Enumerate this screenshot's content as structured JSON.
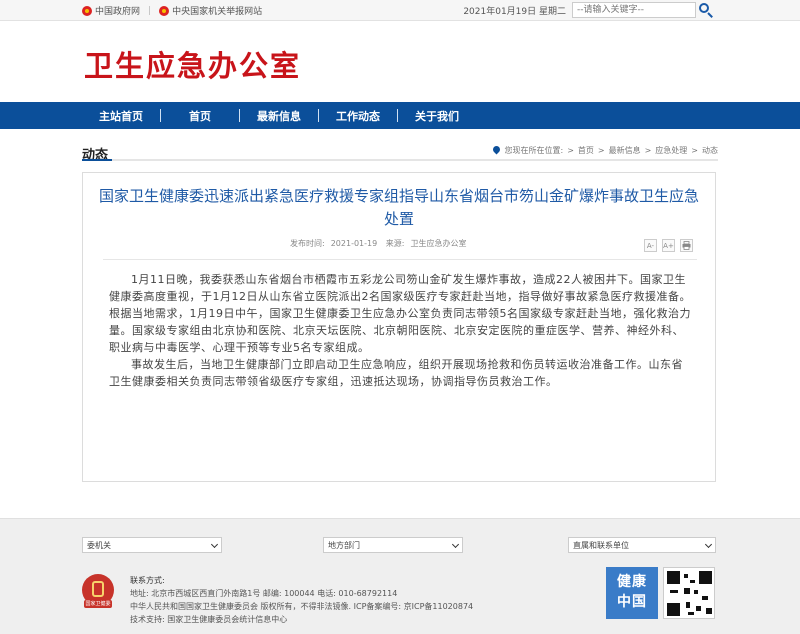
{
  "topbar": {
    "links": [
      "中国政府网",
      "中央国家机关举报网站"
    ],
    "date": "2021年01月19日 星期二",
    "search_placeholder": "--请输入关键字--"
  },
  "header": {
    "site_title": "卫生应急办公室"
  },
  "nav": {
    "items": [
      "主站首页",
      "首页",
      "最新信息",
      "工作动态",
      "关于我们"
    ]
  },
  "section": {
    "title": "动态",
    "breadcrumb_prefix": "您现在所在位置:",
    "breadcrumb": [
      "首页",
      "最新信息",
      "应急处理",
      "动态"
    ]
  },
  "article": {
    "title": "国家卫生健康委迅速派出紧急医疗救援专家组指导山东省烟台市笏山金矿爆炸事故卫生应急处置",
    "publish_label": "发布时间:",
    "publish_date": "2021-01-19",
    "source_label": "来源:",
    "source": "卫生应急办公室",
    "tools": [
      "A-",
      "A+",
      "打印"
    ],
    "paragraphs": [
      "1月11日晚，我委获悉山东省烟台市栖霞市五彩龙公司笏山金矿发生爆炸事故，造成22人被困井下。国家卫生健康委高度重视，于1月12日从山东省立医院派出2名国家级医疗专家赶赴当地，指导做好事故紧急医疗救援准备。根据当地需求，1月19日中午，国家卫生健康委卫生应急办公室负责同志带领5名国家级专家赶赴当地，强化救治力量。国家级专家组由北京协和医院、北京天坛医院、北京朝阳医院、北京安定医院的重症医学、营养、神经外科、职业病与中毒医学、心理干预等专业5名专家组成。",
      "事故发生后，当地卫生健康部门立即启动卫生应急响应，组织开展现场抢救和伤员转运收治准备工作。山东省卫生健康委相关负责同志带领省级医疗专家组，迅速抵达现场，协调指导伤员救治工作。"
    ]
  },
  "footer": {
    "selects": [
      "委机关",
      "地方部门",
      "直属和联系单位"
    ],
    "logo_text": "国家卫健委",
    "contact_title": "联系方式:",
    "address": "地址: 北京市西城区西直门外南路1号    邮编: 100044    电话: 010-68792114",
    "copyright": "中华人民共和国国家卫生健康委员会    版权所有，不得非法镜像.    ICP备案编号: 京ICP备11020874",
    "support": "技术支持: 国家卫生健康委员会统计信息中心",
    "badge_lines": [
      "健康",
      "中国"
    ]
  },
  "colors": {
    "brand_red": "#c8141a",
    "nav_blue": "#0b4f9a",
    "title_blue": "#1f5aa6"
  },
  "icons": [
    "emblem-icon",
    "search-icon",
    "location-pin-icon",
    "font-decrease-icon",
    "font-increase-icon",
    "print-icon",
    "chevron-down-icon",
    "qr-code-icon"
  ]
}
